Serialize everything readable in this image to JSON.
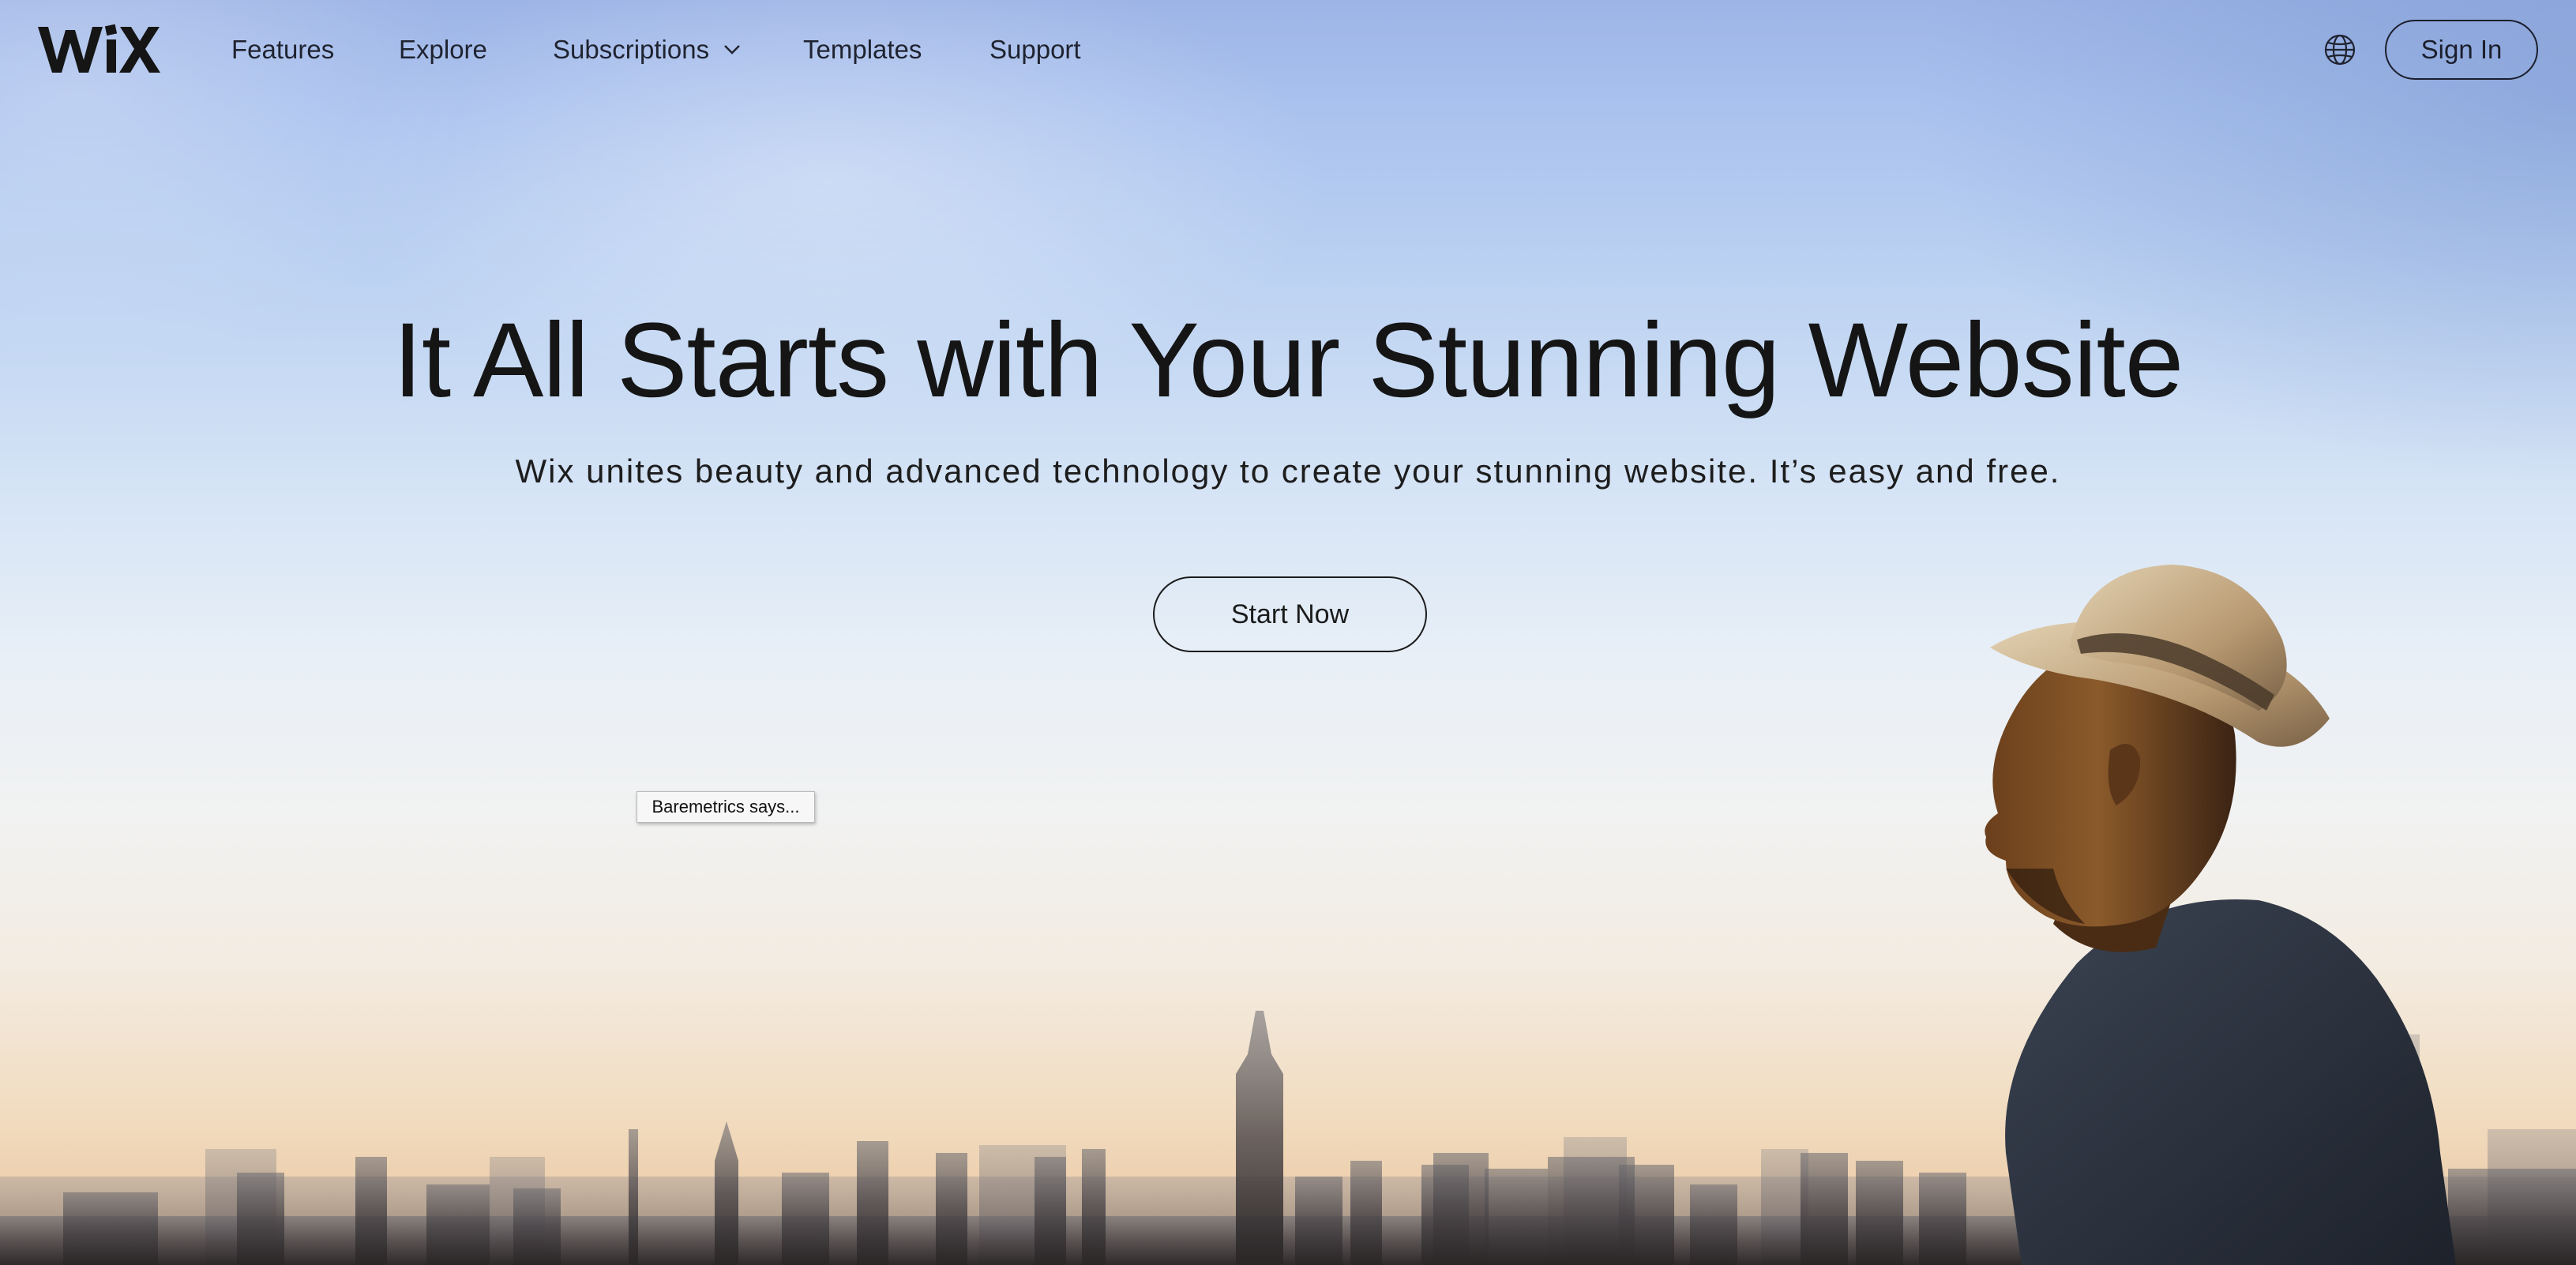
{
  "brand": {
    "logo_text": "WiX"
  },
  "nav": {
    "items": [
      {
        "label": "Features"
      },
      {
        "label": "Explore"
      },
      {
        "label": "Subscriptions",
        "has_dropdown": true
      },
      {
        "label": "Templates"
      },
      {
        "label": "Support"
      }
    ],
    "language_icon": "globe-icon",
    "sign_in_label": "Sign In"
  },
  "hero": {
    "title": "It All Starts with Your Stunning Website",
    "subtitle": "Wix unites beauty and advanced technology to create your stunning website. It’s easy and free.",
    "cta_label": "Start Now"
  },
  "tooltip": {
    "text": "Baremetrics says..."
  },
  "colors": {
    "text": "#161616",
    "sky_top": "#9db4e6",
    "horizon": "#e7c39b"
  }
}
